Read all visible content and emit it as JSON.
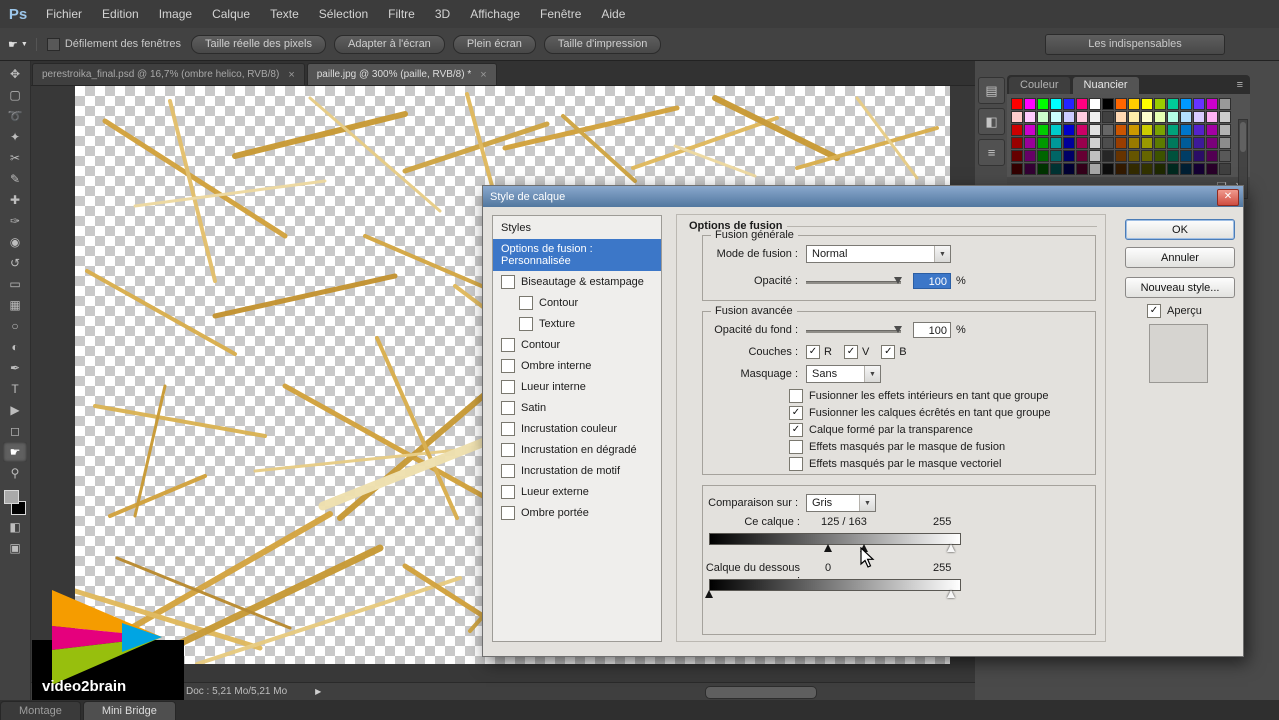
{
  "app": {
    "logo": "Ps",
    "menu": [
      "Fichier",
      "Edition",
      "Image",
      "Calque",
      "Texte",
      "Sélection",
      "Filtre",
      "3D",
      "Affichage",
      "Fenêtre",
      "Aide"
    ]
  },
  "options_bar": {
    "tool_icon": "hand-tool-icon",
    "checkbox_label": "Défilement des fenêtres",
    "buttons": [
      "Taille réelle des pixels",
      "Adapter à l'écran",
      "Plein écran",
      "Taille d'impression"
    ],
    "workspace": "Les indispensables"
  },
  "document_tabs": [
    {
      "label": "perestroika_final.psd @ 16,7% (ombre helico, RVB/8)",
      "active": false
    },
    {
      "label": "paille.jpg @ 300% (paille, RVB/8) *",
      "active": true
    }
  ],
  "toolbar": {
    "tools": [
      {
        "name": "move-tool-icon",
        "glyph": "✥",
        "active": false
      },
      {
        "name": "marquee-tool-icon",
        "glyph": "▢",
        "active": false
      },
      {
        "name": "lasso-tool-icon",
        "glyph": "➰",
        "active": false
      },
      {
        "name": "quick-selection-tool-icon",
        "glyph": "✦",
        "active": false
      },
      {
        "name": "crop-tool-icon",
        "glyph": "✂",
        "active": false
      },
      {
        "name": "eyedropper-tool-icon",
        "glyph": "✎",
        "active": false
      },
      {
        "name": "healing-brush-tool-icon",
        "glyph": "✚",
        "active": false
      },
      {
        "name": "brush-tool-icon",
        "glyph": "✑",
        "active": false
      },
      {
        "name": "clone-stamp-tool-icon",
        "glyph": "◉",
        "active": false
      },
      {
        "name": "history-brush-tool-icon",
        "glyph": "↺",
        "active": false
      },
      {
        "name": "eraser-tool-icon",
        "glyph": "▭",
        "active": false
      },
      {
        "name": "gradient-tool-icon",
        "glyph": "▦",
        "active": false
      },
      {
        "name": "blur-tool-icon",
        "glyph": "○",
        "active": false
      },
      {
        "name": "dodge-tool-icon",
        "glyph": "◐",
        "active": false
      },
      {
        "name": "pen-tool-icon",
        "glyph": "✒",
        "active": false
      },
      {
        "name": "type-tool-icon",
        "glyph": "T",
        "active": false
      },
      {
        "name": "path-selection-tool-icon",
        "glyph": "▶",
        "active": false
      },
      {
        "name": "shape-tool-icon",
        "glyph": "◻",
        "active": false
      },
      {
        "name": "hand-tool-icon",
        "glyph": "☛",
        "active": true
      },
      {
        "name": "zoom-tool-icon",
        "glyph": "⚲",
        "active": false
      }
    ],
    "extras": [
      {
        "name": "quick-mask-icon",
        "glyph": "◧"
      },
      {
        "name": "screen-mode-icon",
        "glyph": "▣"
      }
    ]
  },
  "dialog": {
    "title": "Style de calque",
    "close_glyph": "✕",
    "styles_panel": {
      "header": "Styles",
      "selected": "Options de fusion : Personnalisée",
      "items": [
        {
          "label": "Biseautage & estampage",
          "checked": false,
          "indent": 0
        },
        {
          "label": "Contour",
          "checked": false,
          "indent": 1
        },
        {
          "label": "Texture",
          "checked": false,
          "indent": 1
        },
        {
          "label": "Contour",
          "checked": false,
          "indent": 0
        },
        {
          "label": "Ombre interne",
          "checked": false,
          "indent": 0
        },
        {
          "label": "Lueur interne",
          "checked": false,
          "indent": 0
        },
        {
          "label": "Satin",
          "checked": false,
          "indent": 0
        },
        {
          "label": "Incrustation couleur",
          "checked": false,
          "indent": 0
        },
        {
          "label": "Incrustation en dégradé",
          "checked": false,
          "indent": 0
        },
        {
          "label": "Incrustation de motif",
          "checked": false,
          "indent": 0
        },
        {
          "label": "Lueur externe",
          "checked": false,
          "indent": 0
        },
        {
          "label": "Ombre portée",
          "checked": false,
          "indent": 0
        }
      ]
    },
    "content": {
      "header": "Options de fusion",
      "general": {
        "legend": "Fusion générale",
        "blend_mode_label": "Mode de fusion :",
        "blend_mode_value": "Normal",
        "opacity_label": "Opacité :",
        "opacity_value": "100",
        "opacity_unit": "%"
      },
      "advanced": {
        "legend": "Fusion avancée",
        "fill_label": "Opacité du fond :",
        "fill_value": "100",
        "fill_unit": "%",
        "channels_label": "Couches :",
        "channels": [
          {
            "label": "R",
            "checked": true
          },
          {
            "label": "V",
            "checked": true
          },
          {
            "label": "B",
            "checked": true
          }
        ],
        "knockout_label": "Masquage :",
        "knockout_value": "Sans",
        "checkboxes": [
          {
            "label": "Fusionner les effets intérieurs en tant que groupe",
            "checked": false
          },
          {
            "label": "Fusionner les calques écrêtés en tant que groupe",
            "checked": true
          },
          {
            "label": "Calque formé par la transparence",
            "checked": true
          },
          {
            "label": "Effets masqués par le masque de fusion",
            "checked": false
          },
          {
            "label": "Effets masqués par le masque vectoriel",
            "checked": false
          }
        ]
      },
      "blend_if": {
        "section_label": "Comparaison sur :",
        "mode": "Gris",
        "this_layer": {
          "label": "Ce calque :",
          "text": "125  /  163",
          "max_text": "255",
          "black_values": [
            125,
            163
          ],
          "white_value": 255,
          "max": 255
        },
        "underlying": {
          "label": "Calque du dessous :",
          "text": "0",
          "max_text": "255",
          "black_values": [
            0
          ],
          "white_value": 255,
          "max": 255
        }
      }
    },
    "buttons": {
      "ok": "OK",
      "cancel": "Annuler",
      "new_style": "Nouveau style...",
      "preview_label": "Aperçu",
      "preview_checked": true
    }
  },
  "right_panel": {
    "tabs": [
      {
        "label": "Couleur",
        "active": false
      },
      {
        "label": "Nuancier",
        "active": true
      }
    ],
    "menu_glyph": "≡",
    "dock_icons": [
      {
        "name": "color-panel-icon",
        "glyph": "▤"
      },
      {
        "name": "adjustments-panel-icon",
        "glyph": "◧"
      },
      {
        "name": "layers-panel-icon",
        "glyph": "≡"
      }
    ],
    "footer_icons": [
      {
        "name": "new-swatch-icon",
        "glyph": "❏"
      },
      {
        "name": "delete-swatch-icon",
        "glyph": "✕"
      }
    ],
    "swatch_rows": [
      [
        "#ff0000",
        "#ff00ff",
        "#00ff00",
        "#00ffff",
        "#2323ff",
        "#ff0080",
        "#ffffff",
        "#000000",
        "#ff6600",
        "#ffcc00",
        "#ffff00",
        "#99cc00",
        "#00cc99",
        "#0099ff",
        "#6633ff",
        "#cc00cc",
        "#999999"
      ],
      [
        "#ffcccc",
        "#ffccff",
        "#ccffcc",
        "#ccffff",
        "#ccccff",
        "#ffcce0",
        "#f0f0f0",
        "#404040",
        "#ffd9b3",
        "#ffeeaa",
        "#ffffcc",
        "#e6ffb3",
        "#b3ffe6",
        "#b3e0ff",
        "#d9ccff",
        "#ffb3f5",
        "#cccccc"
      ],
      [
        "#cc0000",
        "#cc00cc",
        "#00cc00",
        "#00cccc",
        "#0000cc",
        "#cc0066",
        "#e0e0e0",
        "#666666",
        "#cc5500",
        "#cc9900",
        "#cccc00",
        "#7aa300",
        "#00a37a",
        "#0077cc",
        "#5522cc",
        "#a300a3",
        "#b3b3b3"
      ],
      [
        "#990000",
        "#990099",
        "#009900",
        "#009999",
        "#000099",
        "#99004d",
        "#d0d0d0",
        "#4d4d4d",
        "#993d00",
        "#997a00",
        "#999900",
        "#5c7a00",
        "#007a5c",
        "#005c99",
        "#3d1a99",
        "#7a007a",
        "#8c8c8c"
      ],
      [
        "#660000",
        "#660066",
        "#006600",
        "#006666",
        "#000066",
        "#660033",
        "#bfbfbf",
        "#262626",
        "#663300",
        "#665500",
        "#666600",
        "#3d5200",
        "#00523d",
        "#003d66",
        "#2a0d66",
        "#520052",
        "#595959"
      ],
      [
        "#330000",
        "#330033",
        "#003300",
        "#003333",
        "#000033",
        "#33001a",
        "#a6a6a6",
        "#0d0d0d",
        "#331a00",
        "#332b00",
        "#333300",
        "#1f2900",
        "#00291f",
        "#001f33",
        "#150033",
        "#290029",
        "#404040"
      ]
    ]
  },
  "status_bar": {
    "doc": "Doc : 5,21 Mo/5,21 Mo"
  },
  "bottom_tabs": [
    {
      "label": "Montage",
      "active": false
    },
    {
      "label": "Mini Bridge",
      "active": true
    }
  ],
  "branding": {
    "text": "video2brain"
  }
}
